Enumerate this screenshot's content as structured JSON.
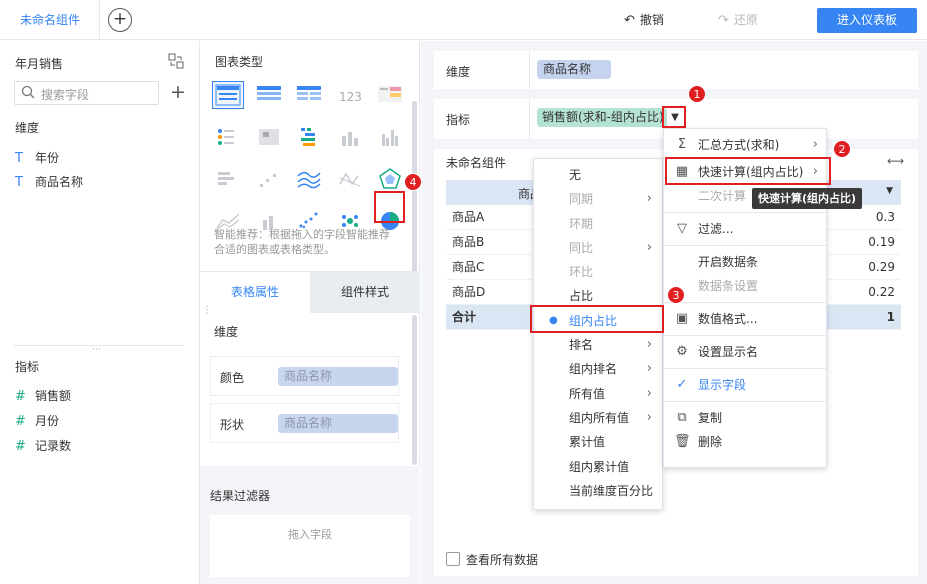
{
  "topbar": {
    "tab_label": "未命名组件",
    "add_tab": "+",
    "undo_label": "撤销",
    "redo_label": "还原",
    "enter_dashboard": "进入仪表板"
  },
  "left": {
    "dataset_name": "年月销售",
    "search_placeholder": "搜索字段",
    "add_symbol": "+",
    "dimension_title": "维度",
    "dimensions": [
      {
        "icon": "T",
        "label": "年份"
      },
      {
        "icon": "T",
        "label": "商品名称"
      }
    ],
    "measure_title": "指标",
    "measures": [
      {
        "icon": "#",
        "label": "销售额"
      },
      {
        "icon": "#",
        "label": "月份"
      },
      {
        "icon": "#",
        "label": "记录数"
      }
    ]
  },
  "middle": {
    "chart_type_title": "图表类型",
    "chart_type_icons": [
      "grouped-table-icon",
      "detail-table-icon",
      "cross-table-icon",
      "kpi-number-icon",
      "colored-table-icon",
      "grid-dots-icon",
      "heatmap-icon",
      "bar-stack-icon",
      "column-chart-icon",
      "grouped-column-icon",
      "horizontal-bar-icon",
      "scatter-step-icon",
      "line-chart-icon",
      "radar-line-icon",
      "radar-icon",
      "area-chart-icon",
      "small-column-icon",
      "scatter-dots-icon",
      "bubble-cluster-icon",
      "pie-chart-icon"
    ],
    "smart_tip": "智能推荐：根据拖入的字段智能推荐合适的图表或表格类型。",
    "tab_table_props": "表格属性",
    "tab_component_style": "组件样式",
    "dimension_label": "维度",
    "color_label": "颜色",
    "color_field": "商品名称",
    "shape_label": "形状",
    "shape_field": "商品名称",
    "result_filter_title": "结果过滤器",
    "drag_field_hint": "拖入字段"
  },
  "right": {
    "dimension_label": "维度",
    "dimension_value": "商品名称",
    "measure_label": "指标",
    "measure_value": "销售额(求和-组内占比)",
    "component_title": "未命名组件",
    "table_header": "商品名称",
    "rows": [
      {
        "name": "商品A",
        "value": "0.3"
      },
      {
        "name": "商品B",
        "value": "0.19"
      },
      {
        "name": "商品C",
        "value": "0.29"
      },
      {
        "name": "商品D",
        "value": "0.22"
      }
    ],
    "total_label": "合计",
    "total_value": "1",
    "view_all_label": "查看所有数据"
  },
  "quick_calc_menu": [
    {
      "label": "无",
      "disabled": false,
      "arrow": false,
      "selected": false
    },
    {
      "label": "同期",
      "disabled": true,
      "arrow": true,
      "selected": false
    },
    {
      "label": "环期",
      "disabled": true,
      "arrow": false,
      "selected": false
    },
    {
      "label": "同比",
      "disabled": true,
      "arrow": true,
      "selected": false
    },
    {
      "label": "环比",
      "disabled": true,
      "arrow": false,
      "selected": false
    },
    {
      "label": "占比",
      "disabled": false,
      "arrow": false,
      "selected": false
    },
    {
      "label": "组内占比",
      "disabled": false,
      "arrow": false,
      "selected": true
    },
    {
      "label": "排名",
      "disabled": false,
      "arrow": true,
      "selected": false
    },
    {
      "label": "组内排名",
      "disabled": false,
      "arrow": true,
      "selected": false
    },
    {
      "label": "所有值",
      "disabled": false,
      "arrow": true,
      "selected": false
    },
    {
      "label": "组内所有值",
      "disabled": false,
      "arrow": true,
      "selected": false
    },
    {
      "label": "累计值",
      "disabled": false,
      "arrow": false,
      "selected": false
    },
    {
      "label": "组内累计值",
      "disabled": false,
      "arrow": false,
      "selected": false
    },
    {
      "label": "当前维度百分比",
      "disabled": false,
      "arrow": false,
      "selected": false
    }
  ],
  "field_menu": {
    "aggregate": "汇总方式(求和)",
    "quick_calc": "快速计算(组内占比)",
    "secondary_calc": "二次计算",
    "filter": "过滤...",
    "open_databar": "开启数据条",
    "databar_settings": "数据条设置",
    "number_format": "数值格式...",
    "display_name": "设置显示名",
    "show_field": "显示字段",
    "copy": "复制",
    "delete": "删除"
  },
  "tooltip": "快速计算(组内占比)",
  "badges": [
    "1",
    "2",
    "3",
    "4"
  ],
  "colors": {
    "accent": "#3685f2",
    "annotation_red": "#e02020",
    "pill_bg": "#c8d5ee",
    "check": "#19ad86"
  }
}
